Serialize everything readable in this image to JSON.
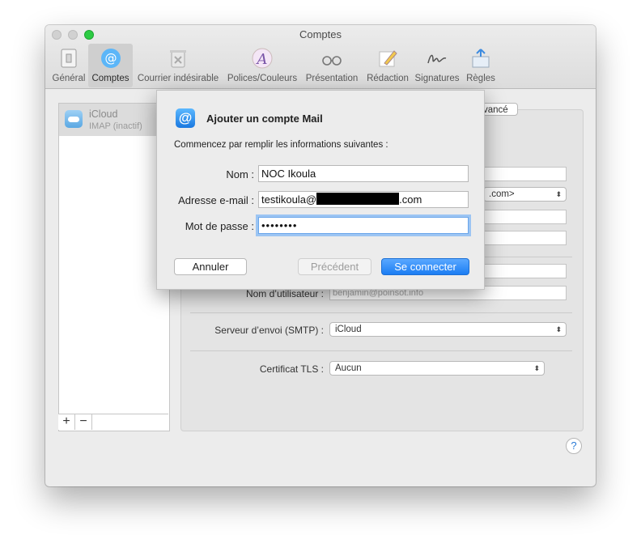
{
  "window": {
    "title": "Comptes"
  },
  "toolbar": {
    "items": [
      {
        "label": "Général",
        "icon": "general-icon"
      },
      {
        "label": "Comptes",
        "icon": "at-icon"
      },
      {
        "label": "Courrier indésirable",
        "icon": "junk-icon"
      },
      {
        "label": "Polices/Couleurs",
        "icon": "fonts-icon"
      },
      {
        "label": "Présentation",
        "icon": "glasses-icon"
      },
      {
        "label": "Rédaction",
        "icon": "pencil-icon"
      },
      {
        "label": "Signatures",
        "icon": "signature-icon"
      },
      {
        "label": "Règles",
        "icon": "rules-icon"
      }
    ],
    "active": "Comptes"
  },
  "sidebar": {
    "account": {
      "name": "iCloud",
      "type": "IMAP (inactif)"
    },
    "add_label": "+",
    "remove_label": "−"
  },
  "background": {
    "tab_label": "vancé",
    "select_top": ".com>",
    "username_label": "Nom d’utilisateur :",
    "username_placeholder": "benjamin@poinsot.info",
    "smtp_label": "Serveur d’envoi (SMTP) :",
    "smtp_value": "iCloud",
    "tls_label": "Certificat TLS :",
    "tls_value": "Aucun",
    "help_label": "?"
  },
  "sheet": {
    "title": "Ajouter un compte Mail",
    "subtitle": "Commencez par remplir les informations suivantes :",
    "name_label": "Nom :",
    "name_value": "NOC Ikoula",
    "email_label": "Adresse e-mail :",
    "email_prefix": "testikoula@",
    "email_suffix": ".com",
    "password_label": "Mot de passe :",
    "password_value": "••••••••",
    "cancel_label": "Annuler",
    "previous_label": "Précédent",
    "connect_label": "Se connecter"
  }
}
